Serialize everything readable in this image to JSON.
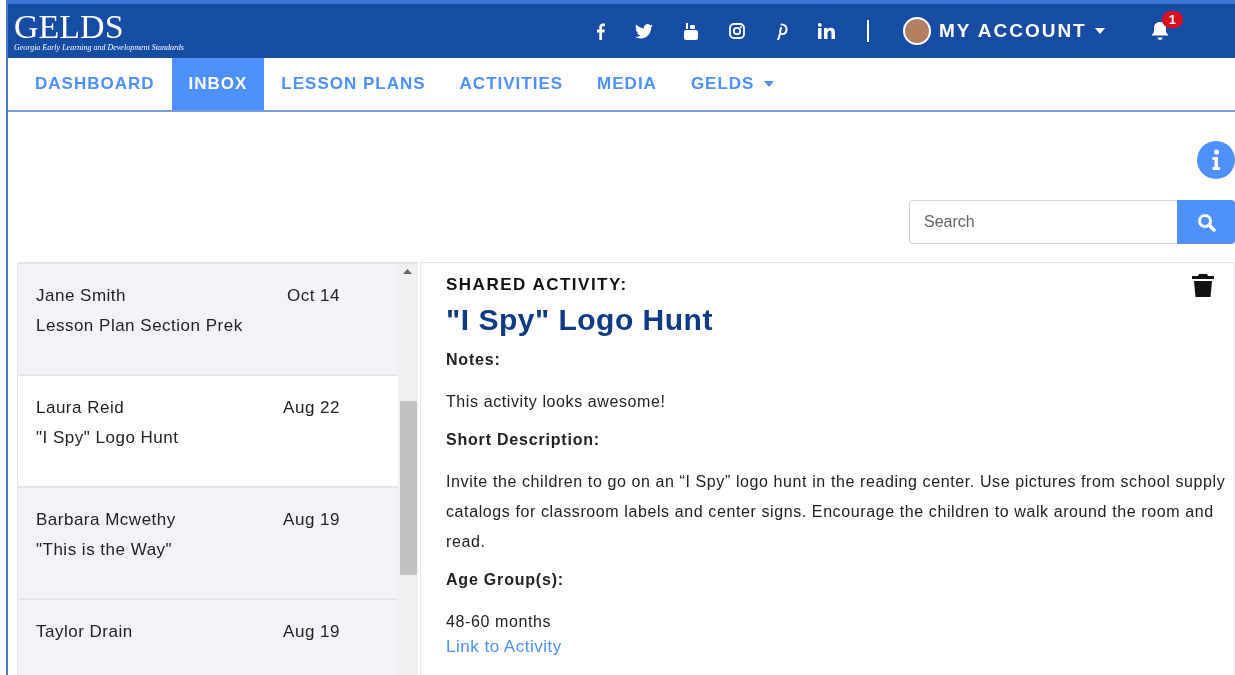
{
  "header": {
    "logo": "GELDS",
    "tagline": "Georgia Early Learning and Development Standards",
    "account": "MY ACCOUNT",
    "notifications": "1"
  },
  "nav": [
    {
      "label": "DASHBOARD",
      "selected": false,
      "dropdown": false
    },
    {
      "label": "INBOX",
      "selected": true,
      "dropdown": false
    },
    {
      "label": "LESSON PLANS",
      "selected": false,
      "dropdown": false
    },
    {
      "label": "ACTIVITIES",
      "selected": false,
      "dropdown": false
    },
    {
      "label": "MEDIA",
      "selected": false,
      "dropdown": false
    },
    {
      "label": "GELDS",
      "selected": false,
      "dropdown": true
    }
  ],
  "search": {
    "placeholder": "Search"
  },
  "messages": [
    {
      "sender": "Jane Smith",
      "subject": "Lesson Plan Section Prek",
      "date": "Oct 14",
      "selected": false
    },
    {
      "sender": "Laura Reid",
      "subject": "\"I Spy\" Logo Hunt",
      "date": "Aug 22",
      "selected": true
    },
    {
      "sender": "Barbara Mcwethy",
      "subject": "\"This is the Way\"",
      "date": "Aug 19",
      "selected": false
    },
    {
      "sender": "Taylor Drain",
      "date": "Aug 19",
      "selected": false
    }
  ],
  "detail": {
    "kicker": "SHARED ACTIVITY:",
    "title": "\"I Spy\" Logo Hunt",
    "sections": [
      {
        "heading": "Notes:",
        "text": "This activity looks awesome!"
      },
      {
        "heading": "Short Description:",
        "text": "Invite the children to go on an “I Spy” logo hunt in the reading center. Use pictures from school supply catalogs for classroom labels and center signs. Encourage the children to walk around the room and read."
      },
      {
        "heading": "Age Group(s):",
        "text": "48-60 months"
      }
    ],
    "link": "Link to Activity"
  }
}
